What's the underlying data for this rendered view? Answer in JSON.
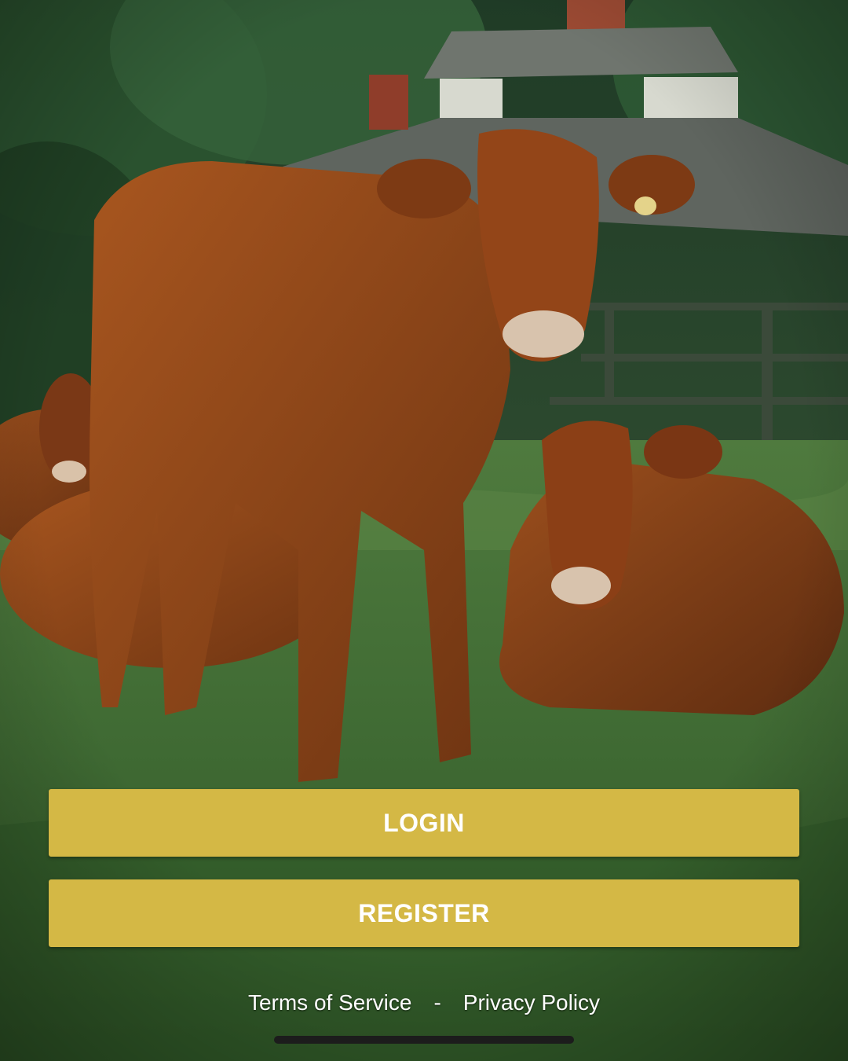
{
  "background": {
    "scene": "cows-in-pasture-photo"
  },
  "actions": {
    "login_label": "LOGIN",
    "register_label": "REGISTER"
  },
  "footer": {
    "terms_label": "Terms of Service",
    "separator": "-",
    "privacy_label": "Privacy Policy"
  },
  "colors": {
    "button": "#d4b845",
    "button_text": "#ffffff",
    "link_text": "#ffffff",
    "home_indicator": "#1c1c1c"
  }
}
